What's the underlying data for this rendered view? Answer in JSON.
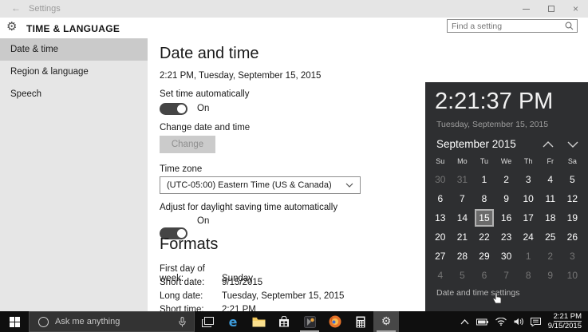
{
  "colors": {
    "titlebar_bg": "#e5e5e5",
    "sidebar_bg": "#e6e6e6",
    "sidebar_selected_bg": "#cacaca",
    "flyout_bg": "#2e2f31",
    "taskbar_bg": "#0f0f0f",
    "toggle_on": "#454545",
    "edge_blue": "#3e9ddd"
  },
  "titlebar": {
    "title": "Settings"
  },
  "header": {
    "title": "TIME & LANGUAGE",
    "gear_glyph": "⚙",
    "search_placeholder": "Find a setting"
  },
  "sidebar": {
    "items": [
      {
        "label": "Date & time",
        "selected": true
      },
      {
        "label": "Region & language",
        "selected": false
      },
      {
        "label": "Speech",
        "selected": false
      }
    ]
  },
  "main": {
    "page_title": "Date and time",
    "current_datetime": "2:21 PM, Tuesday, September 15, 2015",
    "set_time_label": "Set time automatically",
    "set_time_state": "On",
    "change_section_label": "Change date and time",
    "change_button_label": "Change",
    "timezone_label": "Time zone",
    "timezone_value": "(UTC-05:00) Eastern Time (US & Canada)",
    "dst_label": "Adjust for daylight saving time automatically",
    "dst_state": "On",
    "formats_title": "Formats",
    "format_rows": [
      {
        "label": "First day of week:",
        "value": "Sunday"
      },
      {
        "label": "Short date:",
        "value": "9/15/2015"
      },
      {
        "label": "Long date:",
        "value": "Tuesday, September 15, 2015"
      },
      {
        "label": "Short time:",
        "value": "2:21 PM"
      }
    ]
  },
  "clock_flyout": {
    "time": "2:21:37 PM",
    "date": "Tuesday, September 15, 2015",
    "month_label": "September 2015",
    "day_headers": [
      "Su",
      "Mo",
      "Tu",
      "We",
      "Th",
      "Fr",
      "Sa"
    ],
    "weeks": [
      [
        {
          "d": 30,
          "dim": true
        },
        {
          "d": 31,
          "dim": true
        },
        {
          "d": 1
        },
        {
          "d": 2
        },
        {
          "d": 3
        },
        {
          "d": 4
        },
        {
          "d": 5
        }
      ],
      [
        {
          "d": 6
        },
        {
          "d": 7
        },
        {
          "d": 8
        },
        {
          "d": 9
        },
        {
          "d": 10
        },
        {
          "d": 11
        },
        {
          "d": 12
        }
      ],
      [
        {
          "d": 13
        },
        {
          "d": 14
        },
        {
          "d": 15,
          "selected": true
        },
        {
          "d": 16
        },
        {
          "d": 17
        },
        {
          "d": 18
        },
        {
          "d": 19
        }
      ],
      [
        {
          "d": 20
        },
        {
          "d": 21
        },
        {
          "d": 22
        },
        {
          "d": 23
        },
        {
          "d": 24
        },
        {
          "d": 25
        },
        {
          "d": 26
        }
      ],
      [
        {
          "d": 27
        },
        {
          "d": 28
        },
        {
          "d": 29
        },
        {
          "d": 30
        },
        {
          "d": 1,
          "dim": true
        },
        {
          "d": 2,
          "dim": true
        },
        {
          "d": 3,
          "dim": true
        }
      ],
      [
        {
          "d": 4,
          "dim": true
        },
        {
          "d": 5,
          "dim": true
        },
        {
          "d": 6,
          "dim": true
        },
        {
          "d": 7,
          "dim": true
        },
        {
          "d": 8,
          "dim": true
        },
        {
          "d": 9,
          "dim": true
        },
        {
          "d": 10,
          "dim": true
        }
      ]
    ],
    "settings_link": "Date and time settings"
  },
  "taskbar": {
    "search_placeholder": "Ask me anything",
    "settings_gear_glyph": "⚙",
    "tray": {
      "time": "2:21 PM",
      "date": "9/15/2015"
    }
  }
}
